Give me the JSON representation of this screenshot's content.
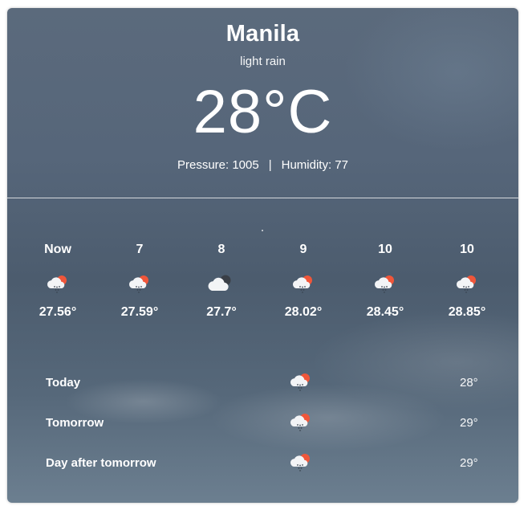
{
  "current": {
    "city": "Manila",
    "description": "light rain",
    "temperature": "28°C",
    "pressure_label": "Pressure: 1005",
    "separator": "|",
    "humidity_label": "Humidity: 77"
  },
  "hourly": [
    {
      "time": "Now",
      "temp": "27.56°",
      "icon": "cloud-sun-rain-icon"
    },
    {
      "time": "7",
      "temp": "27.59°",
      "icon": "cloud-sun-rain-icon"
    },
    {
      "time": "8",
      "temp": "27.7°",
      "icon": "cloud-moon-icon"
    },
    {
      "time": "9",
      "temp": "28.02°",
      "icon": "cloud-sun-rain-icon"
    },
    {
      "time": "10",
      "temp": "28.45°",
      "icon": "cloud-sun-rain-icon"
    },
    {
      "time": "10",
      "temp": "28.85°",
      "icon": "cloud-sun-rain-icon"
    }
  ],
  "daily": [
    {
      "label": "Today",
      "temp": "28°",
      "icon": "cloud-sun-rain-icon"
    },
    {
      "label": "Tomorrow",
      "temp": "29°",
      "icon": "cloud-sun-rain-icon"
    },
    {
      "label": "Day after tomorrow",
      "temp": "29°",
      "icon": "cloud-sun-rain-icon"
    }
  ],
  "colors": {
    "sun": "#f0563a",
    "cloud": "#f3f4f6",
    "rain": "#3b4652",
    "text": "#ffffff"
  }
}
